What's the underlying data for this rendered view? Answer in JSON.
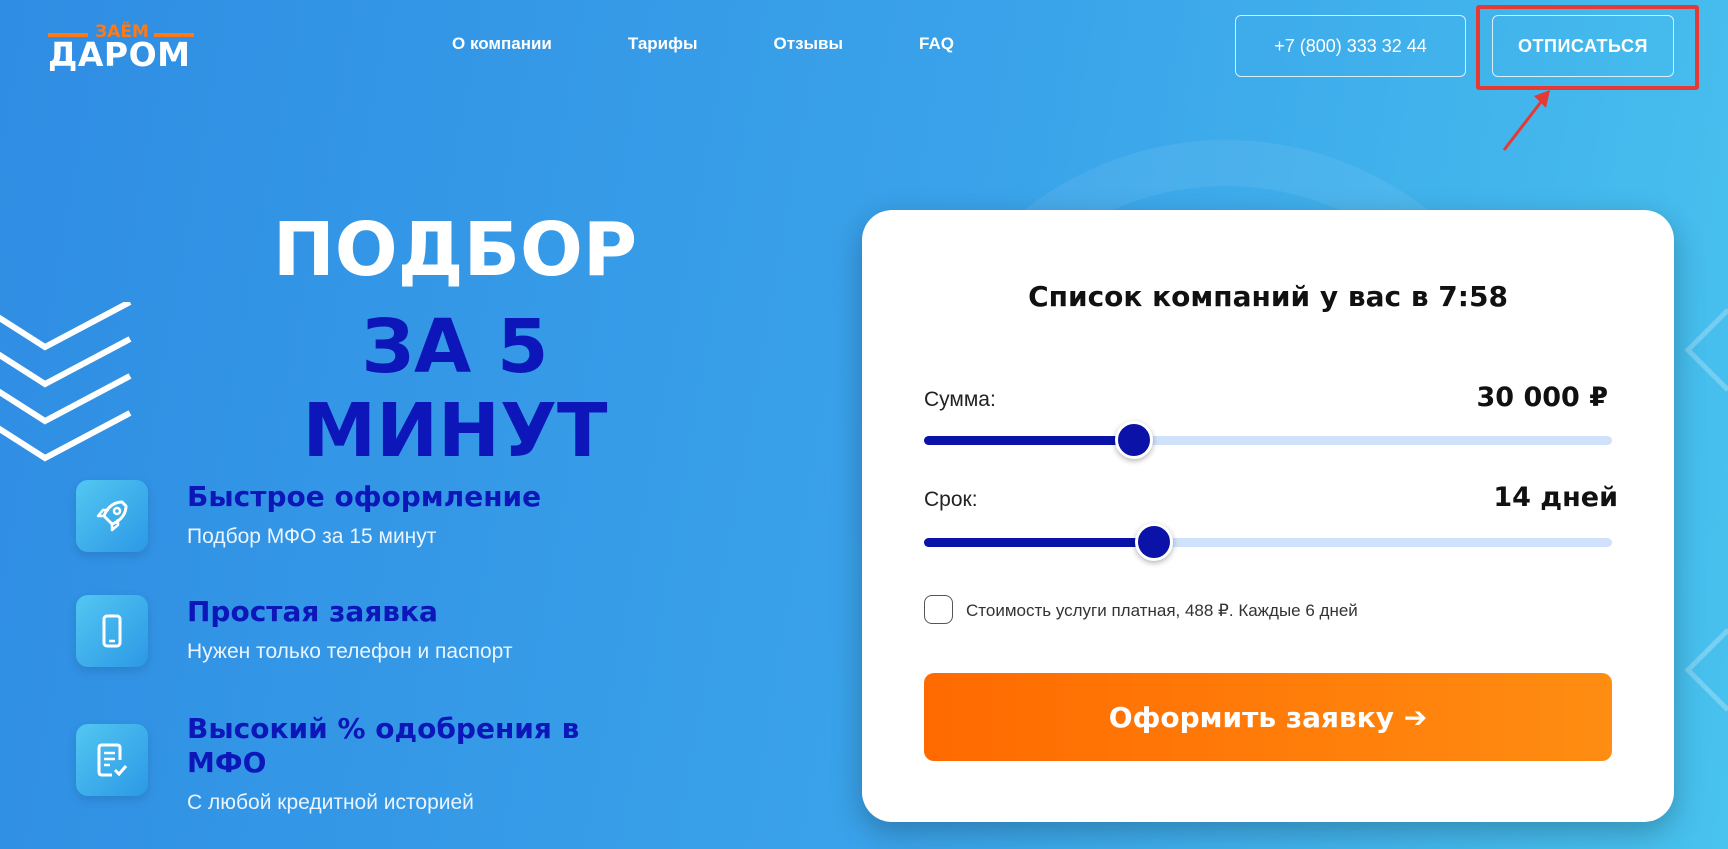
{
  "logo": {
    "top": "ЗАЁМ",
    "main": "ДАРОМ"
  },
  "nav": [
    {
      "label": "О компании"
    },
    {
      "label": "Тарифы"
    },
    {
      "label": "Отзывы"
    },
    {
      "label": "FAQ"
    }
  ],
  "header": {
    "phone": "+7 (800) 333 32 44",
    "unsubscribe": "ОТПИСАТЬСЯ"
  },
  "hero": {
    "title": "ПОДБОР",
    "subtitle": "ЗА 5 МИНУТ"
  },
  "features": [
    {
      "title": "Быстрое оформление",
      "desc": "Подбор МФО за 15 минут",
      "icon": "rocket-icon"
    },
    {
      "title": "Простая заявка",
      "desc": "Нужен только телефон и паспорт",
      "icon": "phone-icon"
    },
    {
      "title": "Высокий % одобрения в МФО",
      "desc": "С любой кредитной историей",
      "icon": "document-check-icon"
    }
  ],
  "form": {
    "title": "Список компаний у вас в 7:58",
    "amount_label": "Сумма:",
    "amount_value": "30 000 ₽",
    "amount_fraction": 0.305,
    "term_label": "Срок:",
    "term_value": "14 дней",
    "term_fraction": 0.335,
    "checkbox_label": "Стоимость услуги платная, 488 ₽. Каждые 6 дней",
    "checkbox_checked": false,
    "submit_label": "Оформить заявку ➔"
  },
  "colors": {
    "accent_orange": "#ff7a17",
    "brand_dark_blue": "#0d16b8",
    "highlight_red": "#e53935"
  }
}
